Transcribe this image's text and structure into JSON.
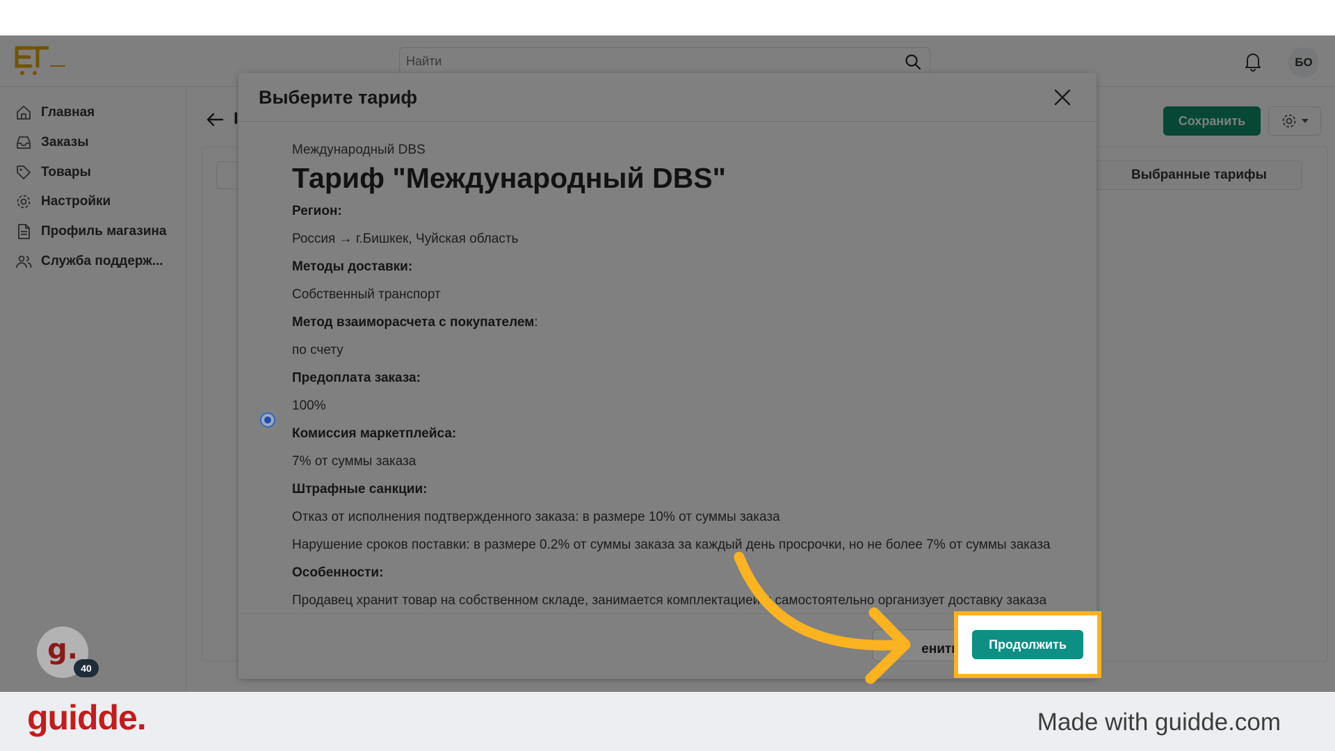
{
  "topbar": {
    "search_placeholder": "Найти",
    "user_initials": "БО"
  },
  "sidebar": {
    "items": [
      {
        "label": "Главная",
        "icon": "home-icon"
      },
      {
        "label": "Заказы",
        "icon": "inbox-icon"
      },
      {
        "label": "Товары",
        "icon": "tag-icon"
      },
      {
        "label": "Настройки",
        "icon": "gear-icon"
      },
      {
        "label": "Профиль магазина",
        "icon": "document-icon"
      },
      {
        "label": "Служба поддерж...",
        "icon": "users-icon"
      }
    ]
  },
  "page": {
    "title_fragment": "I",
    "save_label": "Сохранить",
    "selected_tariffs_tab": "Выбранные тарифы"
  },
  "modal": {
    "title": "Выберите тариф",
    "tariff": {
      "subtitle": "Международный DBS",
      "name": "Тариф \"Международный DBS\"",
      "region_label": "Регион:",
      "region_value": "Россия → г.Бишкек, Чуйская область",
      "delivery_label": "Методы доставки:",
      "delivery_value": "Собственный транспорт",
      "settlement_label": "Метод  взаиморасчета с покупателем",
      "settlement_colon": ":",
      "settlement_value": "по счету",
      "prepay_label": "Предоплата заказа:",
      "prepay_value": "100%",
      "commission_label": "Комиссия маркетплейса:",
      "commission_value": "7% от суммы заказа",
      "penalties_label": "Штрафные санкции:",
      "penalty_1": "Отказ от исполнения подтвержденного заказа: в размере 10% от суммы заказа",
      "penalty_2": "Нарушение сроков поставки: в размере 0.2% от суммы заказа за каждый день просрочки, но не более 7% от суммы заказа",
      "features_label": "Особенности:",
      "features_value": "Продавец хранит товар на собственном складе, занимается комплектацией и самостоятельно организует доставку заказа"
    },
    "change_label": "енить",
    "continue_label": "Продолжить"
  },
  "widget": {
    "letter": "g.",
    "count": "40"
  },
  "branding": {
    "logo": "guidde.",
    "made_with": "Made with guidde.com"
  },
  "colors": {
    "accent": "#0d8f84",
    "highlight": "#fbb320",
    "brand": "#c41c1c"
  }
}
